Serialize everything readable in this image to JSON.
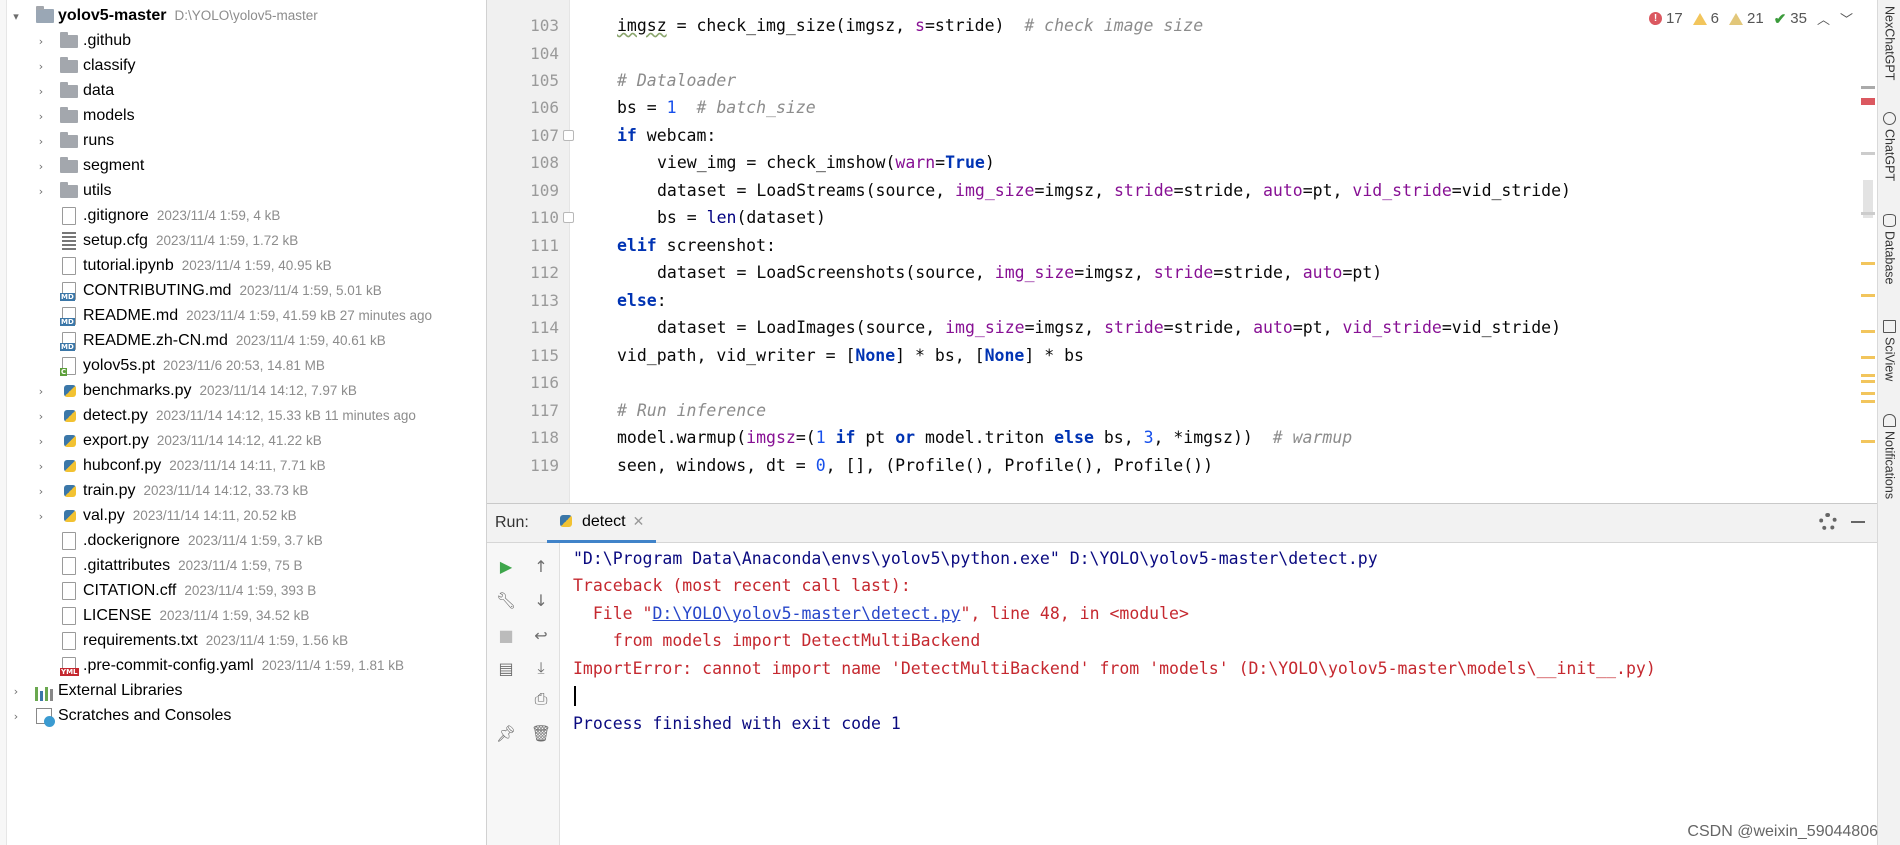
{
  "project": {
    "root": {
      "name": "yolov5-master",
      "path": "D:\\YOLO\\yolov5-master"
    },
    "items": [
      {
        "name": ".github",
        "meta": "",
        "kind": "folder"
      },
      {
        "name": "classify",
        "meta": "",
        "kind": "folder"
      },
      {
        "name": "data",
        "meta": "",
        "kind": "folder"
      },
      {
        "name": "models",
        "meta": "",
        "kind": "folder"
      },
      {
        "name": "runs",
        "meta": "",
        "kind": "folder"
      },
      {
        "name": "segment",
        "meta": "",
        "kind": "folder"
      },
      {
        "name": "utils",
        "meta": "",
        "kind": "folder"
      },
      {
        "name": ".gitignore",
        "meta": "2023/11/4 1:59, 4 kB",
        "kind": "file"
      },
      {
        "name": "setup.cfg",
        "meta": "2023/11/4 1:59, 1.72 kB",
        "kind": "cfg"
      },
      {
        "name": "tutorial.ipynb",
        "meta": "2023/11/4 1:59, 40.95 kB",
        "kind": "file"
      },
      {
        "name": "CONTRIBUTING.md",
        "meta": "2023/11/4 1:59, 5.01 kB",
        "kind": "md"
      },
      {
        "name": "README.md",
        "meta": "2023/11/4 1:59, 41.59 kB 27 minutes ago",
        "kind": "md"
      },
      {
        "name": "README.zh-CN.md",
        "meta": "2023/11/4 1:59, 40.61 kB",
        "kind": "md"
      },
      {
        "name": "yolov5s.pt",
        "meta": "2023/11/6 20:53, 14.81 MB",
        "kind": "pt"
      },
      {
        "name": "benchmarks.py",
        "meta": "2023/11/14 14:12, 7.97 kB",
        "kind": "py"
      },
      {
        "name": "detect.py",
        "meta": "2023/11/14 14:12, 15.33 kB 11 minutes ago",
        "kind": "py"
      },
      {
        "name": "export.py",
        "meta": "2023/11/14 14:12, 41.22 kB",
        "kind": "py"
      },
      {
        "name": "hubconf.py",
        "meta": "2023/11/14 14:11, 7.71 kB",
        "kind": "py"
      },
      {
        "name": "train.py",
        "meta": "2023/11/14 14:12, 33.73 kB",
        "kind": "py"
      },
      {
        "name": "val.py",
        "meta": "2023/11/14 14:11, 20.52 kB",
        "kind": "py"
      },
      {
        "name": ".dockerignore",
        "meta": "2023/11/4 1:59, 3.7 kB",
        "kind": "file"
      },
      {
        "name": ".gitattributes",
        "meta": "2023/11/4 1:59, 75 B",
        "kind": "file"
      },
      {
        "name": "CITATION.cff",
        "meta": "2023/11/4 1:59, 393 B",
        "kind": "file"
      },
      {
        "name": "LICENSE",
        "meta": "2023/11/4 1:59, 34.52 kB",
        "kind": "file"
      },
      {
        "name": "requirements.txt",
        "meta": "2023/11/4 1:59, 1.56 kB",
        "kind": "file"
      },
      {
        "name": ".pre-commit-config.yaml",
        "meta": "2023/11/4 1:59, 1.81 kB",
        "kind": "yml"
      }
    ],
    "external_libraries": "External Libraries",
    "scratches": "Scratches and Consoles"
  },
  "editor": {
    "line_numbers": [
      "103",
      "104",
      "105",
      "106",
      "107",
      "108",
      "109",
      "110",
      "111",
      "112",
      "113",
      "114",
      "115",
      "116",
      "117",
      "118",
      "119"
    ],
    "indicators": {
      "errors": "17",
      "warnings": "6",
      "weak_warnings": "21",
      "ok": "35"
    }
  },
  "right_tools": [
    "NexChatGPT",
    "ChatGPT",
    "Database",
    "SciView",
    "Notifications"
  ],
  "run": {
    "label": "Run:",
    "tab": "detect",
    "console": {
      "cmd": "\"D:\\Program Data\\Anaconda\\envs\\yolov5\\python.exe\" D:\\YOLO\\yolov5-master\\detect.py",
      "traceback": "Traceback (most recent call last):",
      "file_prefix": "  File \"",
      "file_link": "D:\\YOLO\\yolov5-master\\detect.py",
      "file_suffix": "\", line 48, in <module>",
      "import_line": "    from models import DetectMultiBackend",
      "error": "ImportError: cannot import name 'DetectMultiBackend' from 'models' (D:\\YOLO\\yolov5-master\\models\\__init__.py)",
      "finished": "Process finished with exit code 1"
    }
  },
  "watermark": "CSDN @weixin_59044806",
  "colors": {
    "keyword": "#0033b3",
    "comment": "#8c8c8c",
    "param": "#871094",
    "error": "#c5282f",
    "link": "#2746c9",
    "accent": "#4083c9"
  }
}
